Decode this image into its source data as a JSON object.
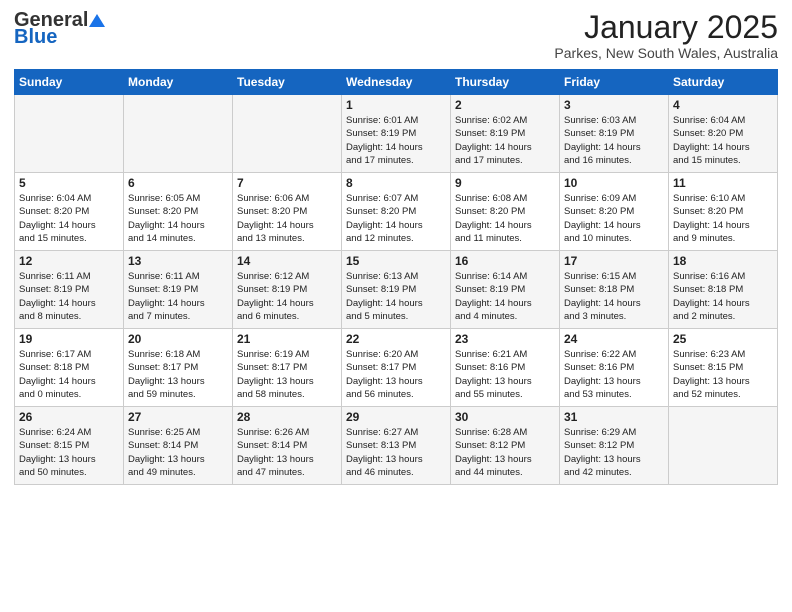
{
  "logo": {
    "general": "General",
    "blue": "Blue"
  },
  "header": {
    "title": "January 2025",
    "subtitle": "Parkes, New South Wales, Australia"
  },
  "days_of_week": [
    "Sunday",
    "Monday",
    "Tuesday",
    "Wednesday",
    "Thursday",
    "Friday",
    "Saturday"
  ],
  "weeks": [
    [
      {
        "day": "",
        "info": ""
      },
      {
        "day": "",
        "info": ""
      },
      {
        "day": "",
        "info": ""
      },
      {
        "day": "1",
        "info": "Sunrise: 6:01 AM\nSunset: 8:19 PM\nDaylight: 14 hours\nand 17 minutes."
      },
      {
        "day": "2",
        "info": "Sunrise: 6:02 AM\nSunset: 8:19 PM\nDaylight: 14 hours\nand 17 minutes."
      },
      {
        "day": "3",
        "info": "Sunrise: 6:03 AM\nSunset: 8:19 PM\nDaylight: 14 hours\nand 16 minutes."
      },
      {
        "day": "4",
        "info": "Sunrise: 6:04 AM\nSunset: 8:20 PM\nDaylight: 14 hours\nand 15 minutes."
      }
    ],
    [
      {
        "day": "5",
        "info": "Sunrise: 6:04 AM\nSunset: 8:20 PM\nDaylight: 14 hours\nand 15 minutes."
      },
      {
        "day": "6",
        "info": "Sunrise: 6:05 AM\nSunset: 8:20 PM\nDaylight: 14 hours\nand 14 minutes."
      },
      {
        "day": "7",
        "info": "Sunrise: 6:06 AM\nSunset: 8:20 PM\nDaylight: 14 hours\nand 13 minutes."
      },
      {
        "day": "8",
        "info": "Sunrise: 6:07 AM\nSunset: 8:20 PM\nDaylight: 14 hours\nand 12 minutes."
      },
      {
        "day": "9",
        "info": "Sunrise: 6:08 AM\nSunset: 8:20 PM\nDaylight: 14 hours\nand 11 minutes."
      },
      {
        "day": "10",
        "info": "Sunrise: 6:09 AM\nSunset: 8:20 PM\nDaylight: 14 hours\nand 10 minutes."
      },
      {
        "day": "11",
        "info": "Sunrise: 6:10 AM\nSunset: 8:20 PM\nDaylight: 14 hours\nand 9 minutes."
      }
    ],
    [
      {
        "day": "12",
        "info": "Sunrise: 6:11 AM\nSunset: 8:19 PM\nDaylight: 14 hours\nand 8 minutes."
      },
      {
        "day": "13",
        "info": "Sunrise: 6:11 AM\nSunset: 8:19 PM\nDaylight: 14 hours\nand 7 minutes."
      },
      {
        "day": "14",
        "info": "Sunrise: 6:12 AM\nSunset: 8:19 PM\nDaylight: 14 hours\nand 6 minutes."
      },
      {
        "day": "15",
        "info": "Sunrise: 6:13 AM\nSunset: 8:19 PM\nDaylight: 14 hours\nand 5 minutes."
      },
      {
        "day": "16",
        "info": "Sunrise: 6:14 AM\nSunset: 8:19 PM\nDaylight: 14 hours\nand 4 minutes."
      },
      {
        "day": "17",
        "info": "Sunrise: 6:15 AM\nSunset: 8:18 PM\nDaylight: 14 hours\nand 3 minutes."
      },
      {
        "day": "18",
        "info": "Sunrise: 6:16 AM\nSunset: 8:18 PM\nDaylight: 14 hours\nand 2 minutes."
      }
    ],
    [
      {
        "day": "19",
        "info": "Sunrise: 6:17 AM\nSunset: 8:18 PM\nDaylight: 14 hours\nand 0 minutes."
      },
      {
        "day": "20",
        "info": "Sunrise: 6:18 AM\nSunset: 8:17 PM\nDaylight: 13 hours\nand 59 minutes."
      },
      {
        "day": "21",
        "info": "Sunrise: 6:19 AM\nSunset: 8:17 PM\nDaylight: 13 hours\nand 58 minutes."
      },
      {
        "day": "22",
        "info": "Sunrise: 6:20 AM\nSunset: 8:17 PM\nDaylight: 13 hours\nand 56 minutes."
      },
      {
        "day": "23",
        "info": "Sunrise: 6:21 AM\nSunset: 8:16 PM\nDaylight: 13 hours\nand 55 minutes."
      },
      {
        "day": "24",
        "info": "Sunrise: 6:22 AM\nSunset: 8:16 PM\nDaylight: 13 hours\nand 53 minutes."
      },
      {
        "day": "25",
        "info": "Sunrise: 6:23 AM\nSunset: 8:15 PM\nDaylight: 13 hours\nand 52 minutes."
      }
    ],
    [
      {
        "day": "26",
        "info": "Sunrise: 6:24 AM\nSunset: 8:15 PM\nDaylight: 13 hours\nand 50 minutes."
      },
      {
        "day": "27",
        "info": "Sunrise: 6:25 AM\nSunset: 8:14 PM\nDaylight: 13 hours\nand 49 minutes."
      },
      {
        "day": "28",
        "info": "Sunrise: 6:26 AM\nSunset: 8:14 PM\nDaylight: 13 hours\nand 47 minutes."
      },
      {
        "day": "29",
        "info": "Sunrise: 6:27 AM\nSunset: 8:13 PM\nDaylight: 13 hours\nand 46 minutes."
      },
      {
        "day": "30",
        "info": "Sunrise: 6:28 AM\nSunset: 8:12 PM\nDaylight: 13 hours\nand 44 minutes."
      },
      {
        "day": "31",
        "info": "Sunrise: 6:29 AM\nSunset: 8:12 PM\nDaylight: 13 hours\nand 42 minutes."
      },
      {
        "day": "",
        "info": ""
      }
    ]
  ]
}
